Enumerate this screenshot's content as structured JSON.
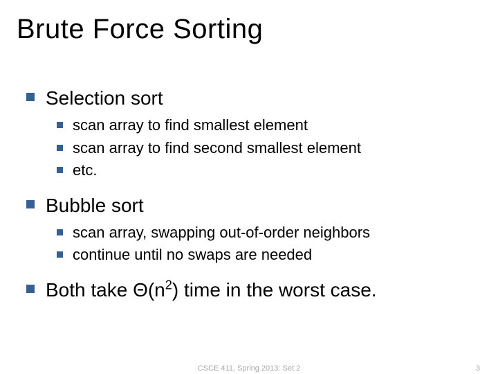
{
  "title": "Brute Force Sorting",
  "items": [
    {
      "label": "Selection sort",
      "sub": [
        {
          "label": "scan array to find smallest element"
        },
        {
          "label": "scan array to find second smallest element"
        },
        {
          "label": "etc."
        }
      ]
    },
    {
      "label": "Bubble sort",
      "sub": [
        {
          "label": "scan array, swapping out-of-order neighbors"
        },
        {
          "label": "continue until no swaps are needed"
        }
      ]
    },
    {
      "label_pre": "Both take Θ(n",
      "label_sup": "2",
      "label_post": ") time in the worst case.",
      "sub": []
    }
  ],
  "footer": {
    "center": "CSCE 411, Spring 2013: Set 2",
    "page": "3"
  },
  "colors": {
    "bullet": "#376092"
  }
}
